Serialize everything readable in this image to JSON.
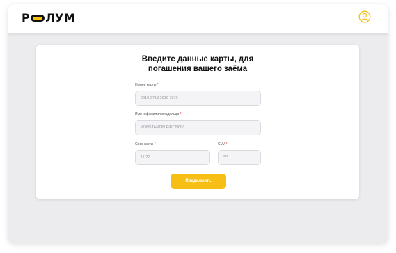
{
  "header": {
    "logo_left": "Р",
    "logo_right": "ЛУМ",
    "brand_color": "#f7be16",
    "profile_icon": "user-circle-icon"
  },
  "form": {
    "title_line1": "Введите данные карты, для",
    "title_line2": "погашения вашего заёма",
    "required_mark": "*",
    "card_number": {
      "label": "Номер карты",
      "value": "2919 2718 2919 7870"
    },
    "holder_name": {
      "label": "Имя и фамилия владельца",
      "value": "KONSTANTIN PIRONOV"
    },
    "expiry": {
      "label": "Срок карты",
      "value": "11/22"
    },
    "cvv": {
      "label": "CVV",
      "value": "***"
    },
    "submit_label": "Продолжить"
  }
}
